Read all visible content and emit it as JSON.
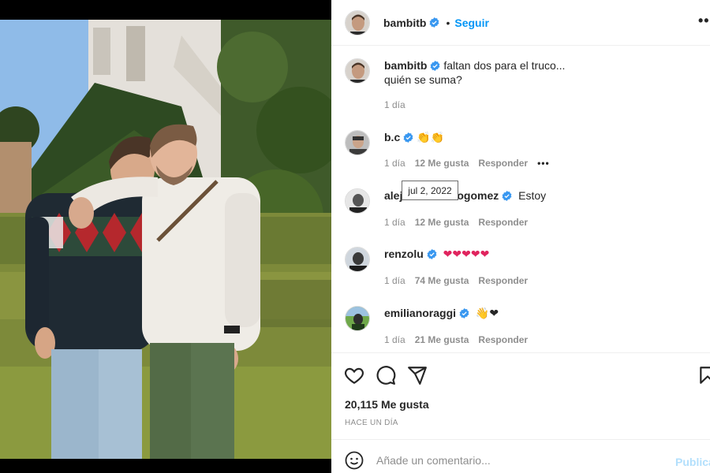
{
  "post": {
    "author": "bambitb",
    "follow_label": "Seguir",
    "dot": "•",
    "more": "•••",
    "caption_line1": "faltan dos para el truco...",
    "caption_line2": "quién se suma?",
    "caption_age": "1 día"
  },
  "comments": [
    {
      "user": "b.c",
      "text": "👏👏",
      "age": "1 día",
      "likes": "12 Me gusta",
      "reply": "Responder",
      "options": "•••"
    },
    {
      "user": "alejandrojogomez",
      "user_visible_start": "alej",
      "user_visible_end": "ogomez",
      "text": "Estoy",
      "age": "1 día",
      "likes": "12 Me gusta",
      "reply": "Responder"
    },
    {
      "user": "renzolu",
      "text": "❤❤❤❤❤",
      "age": "1 día",
      "likes": "74 Me gusta",
      "reply": "Responder"
    },
    {
      "user": "emilianoraggi",
      "text": "👋❤",
      "age": "1 día",
      "likes": "21 Me gusta",
      "reply": "Responder"
    }
  ],
  "tooltip": "jul 2, 2022",
  "stats": {
    "likes": "20,115 Me gusta",
    "time": "HACE UN DÍA"
  },
  "composer": {
    "placeholder": "Añade un comentario...",
    "publish_label": "Publicar"
  },
  "colors": {
    "link": "#0095f6",
    "verified": "#3897f0",
    "muted": "#8e8e8e",
    "heart": "#e0245e",
    "publish_disabled": "#b2dffc"
  },
  "icons": [
    "verified-icon",
    "heart-icon",
    "comment-icon",
    "share-icon",
    "bookmark-icon",
    "smile-icon"
  ]
}
